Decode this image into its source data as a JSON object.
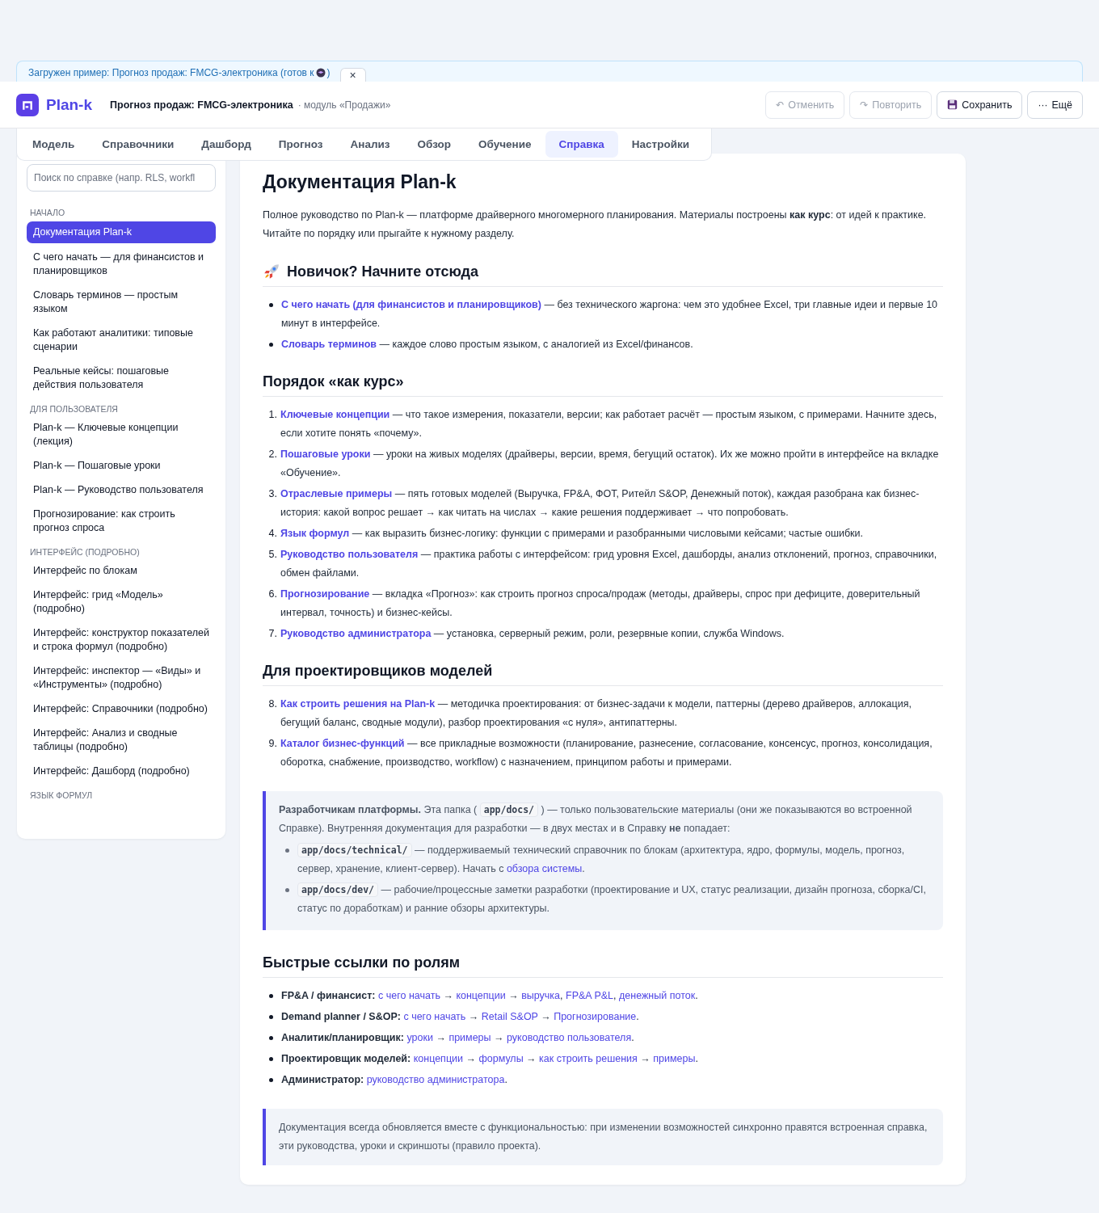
{
  "banner": {
    "text": "Загружен пример: Прогноз продаж: FMCG-электроника (готов к",
    "text_end": ")",
    "close": "×"
  },
  "header": {
    "logo": "Plan-k",
    "title": "Прогноз продаж: FMCG-электроника",
    "subtitle": "· модуль «Продажи»",
    "buttons": [
      {
        "label": "Отменить",
        "icon": "↶",
        "kind": "text",
        "disabled": true
      },
      {
        "label": "Повторить",
        "icon": "↷",
        "kind": "text",
        "disabled": true
      },
      {
        "label": "Сохранить",
        "kind": "save",
        "disabled": false
      },
      {
        "label": "Ещё",
        "icon": "···",
        "kind": "text",
        "disabled": false
      }
    ]
  },
  "tabs": [
    {
      "label": "Модель",
      "selected": false
    },
    {
      "label": "Справочники",
      "selected": false
    },
    {
      "label": "Дашборд",
      "selected": false
    },
    {
      "label": "Прогноз",
      "selected": false
    },
    {
      "label": "Анализ",
      "selected": false
    },
    {
      "label": "Обзор",
      "selected": false
    },
    {
      "label": "Обучение",
      "selected": false
    },
    {
      "label": "Справка",
      "selected": true
    },
    {
      "label": "Настройки",
      "selected": false
    }
  ],
  "sidebar": {
    "search": {
      "placeholder": "Поиск по справке (напр. RLS, workfl"
    },
    "sections": [
      {
        "heading": "НАЧАЛО",
        "items": [
          {
            "label": "Документация Plan-k",
            "selected": true
          },
          {
            "label": "С чего начать — для финансистов и планировщиков",
            "selected": false
          },
          {
            "label": "Словарь терминов — простым языком",
            "selected": false
          },
          {
            "label": "Как работают аналитики: типовые сценарии",
            "selected": false
          },
          {
            "label": "Реальные кейсы: пошаговые действия пользователя",
            "selected": false
          }
        ]
      },
      {
        "heading": "ДЛЯ ПОЛЬЗОВАТЕЛЯ",
        "items": [
          {
            "label": "Plan-k — Ключевые концепции (лекция)",
            "selected": false
          },
          {
            "label": "Plan-k — Пошаговые уроки",
            "selected": false
          },
          {
            "label": "Plan-k — Руководство пользователя",
            "selected": false
          },
          {
            "label": "Прогнозирование: как строить прогноз спроса",
            "selected": false
          }
        ]
      },
      {
        "heading": "ИНТЕРФЕЙС (ПОДРОБНО)",
        "items": [
          {
            "label": "Интерфейс по блокам",
            "selected": false
          },
          {
            "label": "Интерфейс: грид «Модель» (подробно)",
            "selected": false
          },
          {
            "label": "Интерфейс: конструктор показателей и строка формул (подробно)",
            "selected": false
          },
          {
            "label": "Интерфейс: инспектор — «Виды» и «Инструменты» (подробно)",
            "selected": false
          },
          {
            "label": "Интерфейс: Справочники (подробно)",
            "selected": false
          },
          {
            "label": "Интерфейс: Анализ и сводные таблицы (подробно)",
            "selected": false
          },
          {
            "label": "Интерфейс: Дашборд (подробно)",
            "selected": false
          }
        ]
      },
      {
        "heading": "ЯЗЫК ФОРМУЛ"
      }
    ]
  },
  "doc": {
    "title": "Документация Plan-k",
    "intro": [
      {
        "kind": "text",
        "text": "Полное руководство по Plan-k — платформе драйверного многомерного планирования. Материалы построены "
      },
      {
        "kind": "bold",
        "text": "как курс"
      },
      {
        "kind": "text",
        "text": ": от идей к практике. Читайте по порядку или прыгайте к нужному разделу."
      }
    ],
    "sections": [
      {
        "heading": "Новичок? Начните отсюда",
        "blocks": [
          {
            "kind": "ul",
            "items": [
              [
                {
                  "kind": "link",
                  "text": "С чего начать (для финансистов и планировщиков)"
                },
                {
                  "kind": "text",
                  "text": " — без технического жаргона: чем это удобнее Excel, три главные идеи и первые 10 минут в интерфейсе."
                }
              ],
              [
                {
                  "kind": "link",
                  "text": "Словарь терминов"
                },
                {
                  "kind": "text",
                  "text": " — каждое слово простым языком, с аналогией из Excel/финансов."
                }
              ]
            ]
          }
        ]
      },
      {
        "heading": "Порядок «как курс»",
        "blocks": [
          {
            "kind": "ol",
            "items": [
              {
                "number": "1.",
                "segs": [
                  {
                    "kind": "link",
                    "text": "Ключевые концепции"
                  },
                  {
                    "kind": "text",
                    "text": " — что такое измерения, показатели, версии; как работает расчёт — простым языком, с примерами. Начните здесь, если хотите понять «почему»."
                  }
                ]
              },
              {
                "number": "2.",
                "segs": [
                  {
                    "kind": "link",
                    "text": "Пошаговые уроки"
                  },
                  {
                    "kind": "text",
                    "text": " — уроки на живых моделях (драйверы, версии, время, бегущий остаток). Их же можно пройти в интерфейсе на вкладке «Обучение»."
                  }
                ]
              },
              {
                "number": "3.",
                "segs": [
                  {
                    "kind": "link",
                    "text": "Отраслевые примеры"
                  },
                  {
                    "kind": "text",
                    "text": " — пять готовых моделей (Выручка, FP&A, ФОТ, Ритейл S&OP, Денежный поток), каждая разобрана как бизнес-история: какой вопрос решает → как читать на числах → какие решения поддерживает → что попробовать."
                  }
                ]
              },
              {
                "number": "4.",
                "segs": [
                  {
                    "kind": "link",
                    "text": "Язык формул"
                  },
                  {
                    "kind": "text",
                    "text": " — как выразить бизнес-логику: функции с примерами и разобранными числовыми кейсами; частые ошибки."
                  }
                ]
              },
              {
                "number": "5.",
                "segs": [
                  {
                    "kind": "link",
                    "text": "Руководство пользователя"
                  },
                  {
                    "kind": "text",
                    "text": " — практика работы с интерфейсом: грид уровня Excel, дашборды, анализ отклонений, прогноз, справочники, обмен файлами."
                  }
                ]
              },
              {
                "number": "6.",
                "segs": [
                  {
                    "kind": "link",
                    "text": "Прогнозирование"
                  },
                  {
                    "kind": "text",
                    "text": " — вкладка «Прогноз»: как строить прогноз спроса/продаж (методы, драйверы, спрос при дефиците, доверительный интервал, точность) и бизнес-кейсы."
                  }
                ]
              },
              {
                "number": "7.",
                "segs": [
                  {
                    "kind": "link",
                    "text": "Руководство администратора"
                  },
                  {
                    "kind": "text",
                    "text": " — установка, серверный режим, роли, резервные копии, служба Windows."
                  }
                ]
              }
            ]
          }
        ]
      },
      {
        "heading": "Для проектировщиков моделей",
        "blocks": [
          {
            "kind": "ol",
            "items": [
              {
                "number": "8.",
                "segs": [
                  {
                    "kind": "link",
                    "text": "Как строить решения на Plan-k"
                  },
                  {
                    "kind": "text",
                    "text": " — методичка проектирования: от бизнес-задачи к модели, паттерны (дерево драйверов, аллокация, бегущий баланс, сводные модули), разбор проектирования «с нуля», антипаттерны."
                  }
                ]
              },
              {
                "number": "9.",
                "segs": [
                  {
                    "kind": "link",
                    "text": "Каталог бизнес-функций"
                  },
                  {
                    "kind": "text",
                    "text": " — все прикладные возможности (планирование, разнесение, согласование, консенсус, прогноз, консолидация, оборотка, снабжение, производство, workflow) с назначением, принципом работы и примерами."
                  }
                ]
              }
            ]
          },
          {
            "kind": "note",
            "segs": [
              {
                "kind": "bold",
                "text": "Разработчикам платформы."
              },
              {
                "kind": "text",
                "text": " Эта папка ( "
              },
              {
                "kind": "code",
                "text": "app/docs/"
              },
              {
                "kind": "text",
                "text": " ) — только пользовательские материалы (они же показываются во встроенной Справке). Внутренняя документация для разработки — в двух местах и в Справку "
              },
              {
                "kind": "bold",
                "text": "не"
              },
              {
                "kind": "text",
                "text": " попадает:"
              }
            ],
            "items": [
              [
                {
                  "kind": "code",
                  "text": "app/docs/technical/"
                },
                {
                  "kind": "text",
                  "text": " — поддерживаемый технический справочник по блокам (архитектура, ядро, формулы, модель, прогноз, сервер, хранение, клиент-сервер). Начать с "
                },
                {
                  "kind": "link",
                  "text": "обзора системы"
                },
                {
                  "kind": "text",
                  "text": "."
                }
              ],
              [
                {
                  "kind": "code",
                  "text": "app/docs/dev/"
                },
                {
                  "kind": "text",
                  "text": " — рабочие/процессные заметки разработки (проектирование и UX, статус реализации, дизайн прогноза, сборка/CI, статус по доработкам) и ранние обзоры архитектуры."
                }
              ]
            ]
          }
        ]
      },
      {
        "heading": "Быстрые ссылки по ролям",
        "blocks": [
          {
            "kind": "ul",
            "items": [
              [
                {
                  "kind": "bold",
                  "text": "FP&A / финансист: "
                },
                {
                  "kind": "link",
                  "text": "с чего начать"
                },
                {
                  "kind": "text",
                  "text": " → "
                },
                {
                  "kind": "link",
                  "text": "концепции"
                },
                {
                  "kind": "text",
                  "text": " → "
                },
                {
                  "kind": "link",
                  "text": "выручка"
                },
                {
                  "kind": "text",
                  "text": ", "
                },
                {
                  "kind": "link",
                  "text": "FP&A P&L"
                },
                {
                  "kind": "text",
                  "text": ", "
                },
                {
                  "kind": "link",
                  "text": "денежный поток"
                },
                {
                  "kind": "text",
                  "text": "."
                }
              ],
              [
                {
                  "kind": "bold",
                  "text": "Demand planner / S&OP: "
                },
                {
                  "kind": "link",
                  "text": "с чего начать"
                },
                {
                  "kind": "text",
                  "text": " → "
                },
                {
                  "kind": "link",
                  "text": "Retail S&OP"
                },
                {
                  "kind": "text",
                  "text": " → "
                },
                {
                  "kind": "link",
                  "text": "Прогнозирование"
                },
                {
                  "kind": "text",
                  "text": "."
                }
              ],
              [
                {
                  "kind": "bold",
                  "text": "Аналитик/планировщик: "
                },
                {
                  "kind": "link",
                  "text": "уроки"
                },
                {
                  "kind": "text",
                  "text": " → "
                },
                {
                  "kind": "link",
                  "text": "примеры"
                },
                {
                  "kind": "text",
                  "text": " → "
                },
                {
                  "kind": "link",
                  "text": "руководство пользователя"
                },
                {
                  "kind": "text",
                  "text": "."
                }
              ],
              [
                {
                  "kind": "bold",
                  "text": "Проектировщик моделей: "
                },
                {
                  "kind": "link",
                  "text": "концепции"
                },
                {
                  "kind": "text",
                  "text": " → "
                },
                {
                  "kind": "link",
                  "text": "формулы"
                },
                {
                  "kind": "text",
                  "text": " → "
                },
                {
                  "kind": "link",
                  "text": "как строить решения"
                },
                {
                  "kind": "text",
                  "text": " → "
                },
                {
                  "kind": "link",
                  "text": "примеры"
                },
                {
                  "kind": "text",
                  "text": "."
                }
              ],
              [
                {
                  "kind": "bold",
                  "text": "Администратор: "
                },
                {
                  "kind": "link",
                  "text": "руководство администратора"
                },
                {
                  "kind": "text",
                  "text": "."
                }
              ]
            ]
          },
          {
            "kind": "note",
            "segs": [
              {
                "kind": "text",
                "text": "Документация всегда обновляется вместе с функциональностью: при изменении возможностей синхронно правятся встроенная справка, эти руководства, уроки и скриншоты (правило проекта)."
              }
            ]
          }
        ]
      }
    ]
  }
}
